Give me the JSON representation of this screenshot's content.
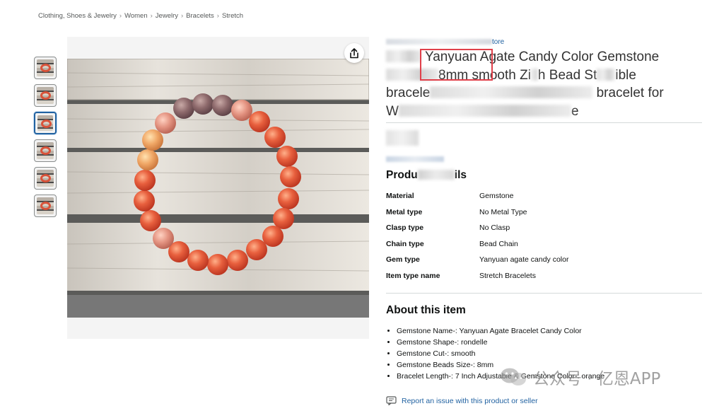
{
  "breadcrumb": {
    "items": [
      "Clothing, Shoes & Jewelry",
      "Women",
      "Jewelry",
      "Bracelets",
      "Stretch"
    ],
    "separator": "›"
  },
  "store_link_visible": "tore",
  "title": {
    "line1_text": "Yanyuan Agate Candy Color Gemstone",
    "line2_fragment_a": "8mm smooth Zi",
    "line2_fragment_b": "h Bead St",
    "line2_fragment_c": "ible",
    "line3_fragment_a": "bracele",
    "line3_fragment_b": "bracelet for",
    "line4_fragment_a": "W",
    "line4_fragment_b": "e"
  },
  "details": {
    "heading_visible_a": "Produ",
    "heading_visible_b": "ils",
    "rows": [
      {
        "key": "Material",
        "value": "Gemstone"
      },
      {
        "key": "Metal type",
        "value": "No Metal Type"
      },
      {
        "key": "Clasp type",
        "value": "No Clasp"
      },
      {
        "key": "Chain type",
        "value": "Bead Chain"
      },
      {
        "key": "Gem type",
        "value": "Yanyuan agate candy color"
      },
      {
        "key": "Item type name",
        "value": "Stretch Bracelets"
      }
    ]
  },
  "about": {
    "heading": "About this item",
    "bullets": [
      "Gemstone Name-: Yanyuan Agate Bracelet Candy Color",
      "Gemstone Shape-: rondelle",
      "Gemstone Cut-: smooth",
      "Gemstone Beads Size-: 8mm",
      "Bracelet Length-: 7 Inch Adjustable & Gemstone Color-: orange"
    ]
  },
  "report_link": "Report an issue with this product or seller",
  "watermark_text": "公众号 · 亿恩APP",
  "colors": {
    "link": "#2162a1",
    "highlight_box": "#e0404a",
    "selected_thumb": "#2162a1"
  },
  "icons": {
    "share": "share-icon",
    "report": "report-flag-icon",
    "watermark": "wechat-icon"
  }
}
